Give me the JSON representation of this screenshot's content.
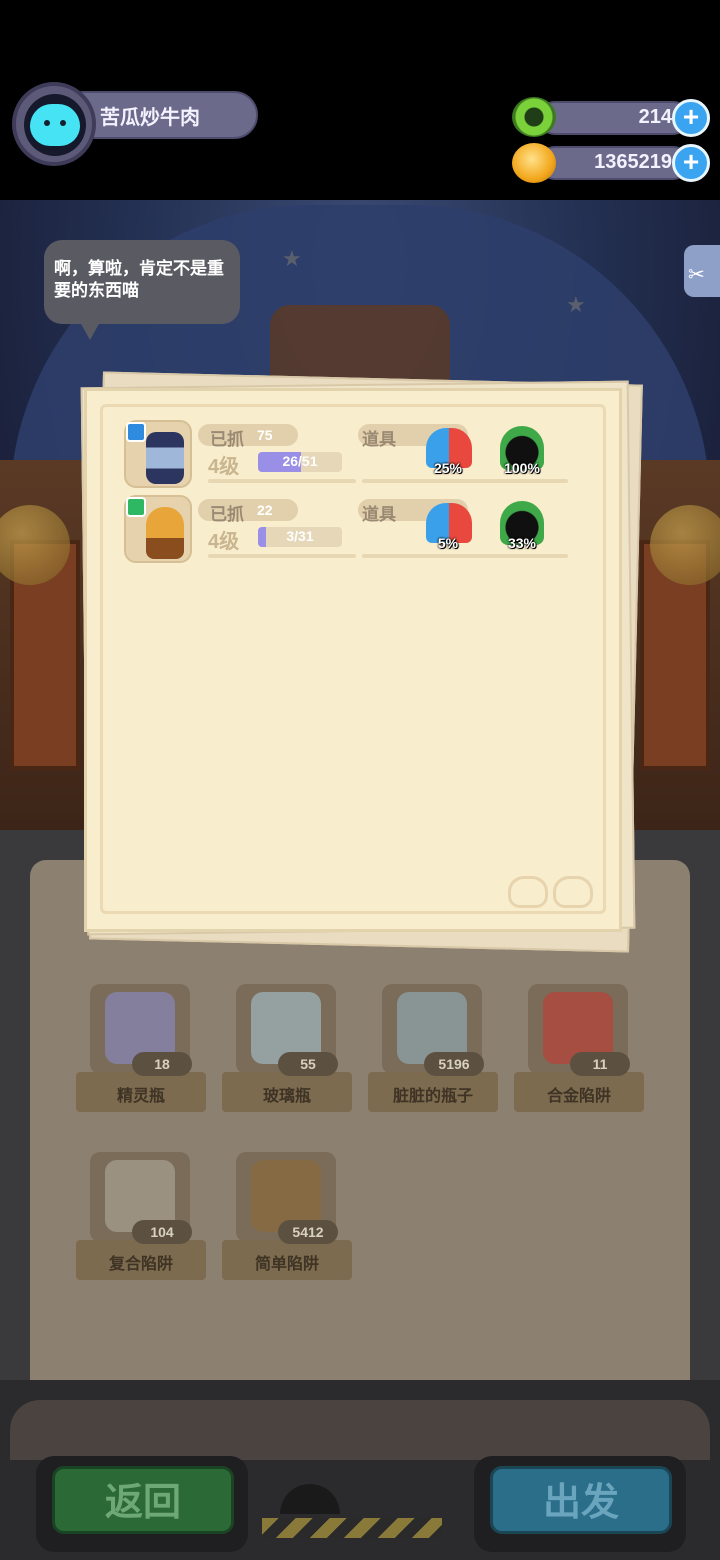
{
  "player": {
    "name": "苦瓜炒牛肉"
  },
  "currency": {
    "gems": {
      "value": "214",
      "icon": "green-donut-icon"
    },
    "coins": {
      "value": "1365219",
      "icon": "gold-planet-coin-icon"
    }
  },
  "speech_bubble": {
    "text": "啊，算啦，肯定不是重要的东西喵"
  },
  "creatures": [
    {
      "caught_label": "已抓",
      "caught": "75",
      "level": "4级",
      "xp": "26/51",
      "xp_fraction": 0.51,
      "items_label": "道具",
      "items": [
        {
          "icon": "wizard-hat-icon",
          "percent": "25%"
        },
        {
          "icon": "jester-crown-icon",
          "percent": "100%"
        }
      ]
    },
    {
      "caught_label": "已抓",
      "caught": "22",
      "level": "4级",
      "xp": "3/31",
      "xp_fraction": 0.097,
      "items_label": "道具",
      "items": [
        {
          "icon": "wizard-hat-icon",
          "percent": "5%"
        },
        {
          "icon": "jester-crown-icon",
          "percent": "33%"
        }
      ]
    }
  ],
  "inventory": [
    {
      "name": "精灵瓶",
      "count": "18"
    },
    {
      "name": "玻璃瓶",
      "count": "55"
    },
    {
      "name": "脏脏的瓶子",
      "count": "5196"
    },
    {
      "name": "合金陷阱",
      "count": "11"
    },
    {
      "name": "复合陷阱",
      "count": "104"
    },
    {
      "name": "简单陷阱",
      "count": "5412"
    }
  ],
  "buttons": {
    "back": "返回",
    "depart": "出发"
  },
  "colors": {
    "xp_fill": "#9a8fe6",
    "paper": "#f8edcc",
    "back_button": "#2b6a37",
    "depart_button": "#2a6e8a"
  }
}
